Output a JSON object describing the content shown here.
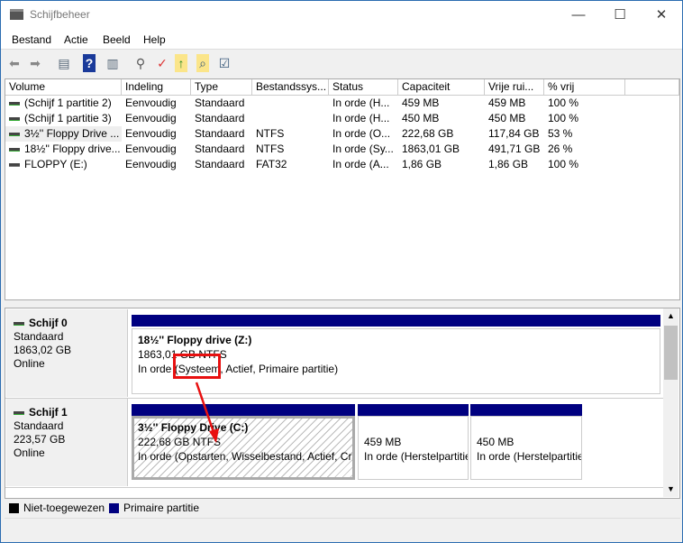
{
  "window": {
    "title": "Schijfbeheer",
    "minimize": "—",
    "maximize": "☐",
    "close": "✕"
  },
  "menu": [
    "Bestand",
    "Actie",
    "Beeld",
    "Help"
  ],
  "toolbar": [
    "back-icon",
    "forward-icon",
    "console-tree-icon",
    "help-icon",
    "action-pane-icon",
    "connect-drive-icon",
    "properties-icon",
    "up-folder-icon",
    "search-folder-icon",
    "checklist-icon"
  ],
  "columns": [
    "Volume",
    "Indeling",
    "Type",
    "Bestandssys...",
    "Status",
    "Capaciteit",
    "Vrije rui...",
    "% vrij"
  ],
  "rows": [
    [
      "(Schijf 1 partitie 2)",
      "Eenvoudig",
      "Standaard",
      "",
      "In orde (H...",
      "459 MB",
      "459 MB",
      "100 %"
    ],
    [
      "(Schijf 1 partitie 3)",
      "Eenvoudig",
      "Standaard",
      "",
      "In orde (H...",
      "450 MB",
      "450 MB",
      "100 %"
    ],
    [
      "3½'' Floppy Drive ...",
      "Eenvoudig",
      "Standaard",
      "NTFS",
      "In orde (O...",
      "222,68 GB",
      "117,84 GB",
      "53 %"
    ],
    [
      "18½'' Floppy drive...",
      "Eenvoudig",
      "Standaard",
      "NTFS",
      "In orde (Sy...",
      "1863,01 GB",
      "491,71 GB",
      "26 %"
    ],
    [
      "FLOPPY (E:)",
      "Eenvoudig",
      "Standaard",
      "FAT32",
      "In orde (A...",
      "1,86 GB",
      "1,86 GB",
      "100 %"
    ]
  ],
  "disks": [
    {
      "name": "Schijf 0",
      "type": "Standaard",
      "size": "1863,02 GB",
      "state": "Online",
      "partitions": [
        {
          "title": "18½'' Floppy drive  (Z:)",
          "fs": "1863,01 GB NTFS",
          "status": "In orde (Systeem, Actief, Primaire partitie)"
        }
      ]
    },
    {
      "name": "Schijf 1",
      "type": "Standaard",
      "size": "223,57 GB",
      "state": "Online",
      "partitions": [
        {
          "title": "3½'' Floppy Drive  (C:)",
          "fs": "222,68 GB NTFS",
          "status": "In orde (Opstarten, Wisselbestand, Actief, Crashdump, Primaire partitie)"
        },
        {
          "title": "",
          "fs": "459 MB",
          "status": "In orde (Herstelpartitie)"
        },
        {
          "title": "",
          "fs": "450 MB",
          "status": "In orde (Herstelpartitie)"
        }
      ]
    }
  ],
  "legend": [
    {
      "label": "Niet-toegewezen",
      "color": "#000000"
    },
    {
      "label": "Primaire partitie",
      "color": "#000080"
    }
  ],
  "colors": {
    "primary": "#000080",
    "annotation": "#e81010"
  }
}
